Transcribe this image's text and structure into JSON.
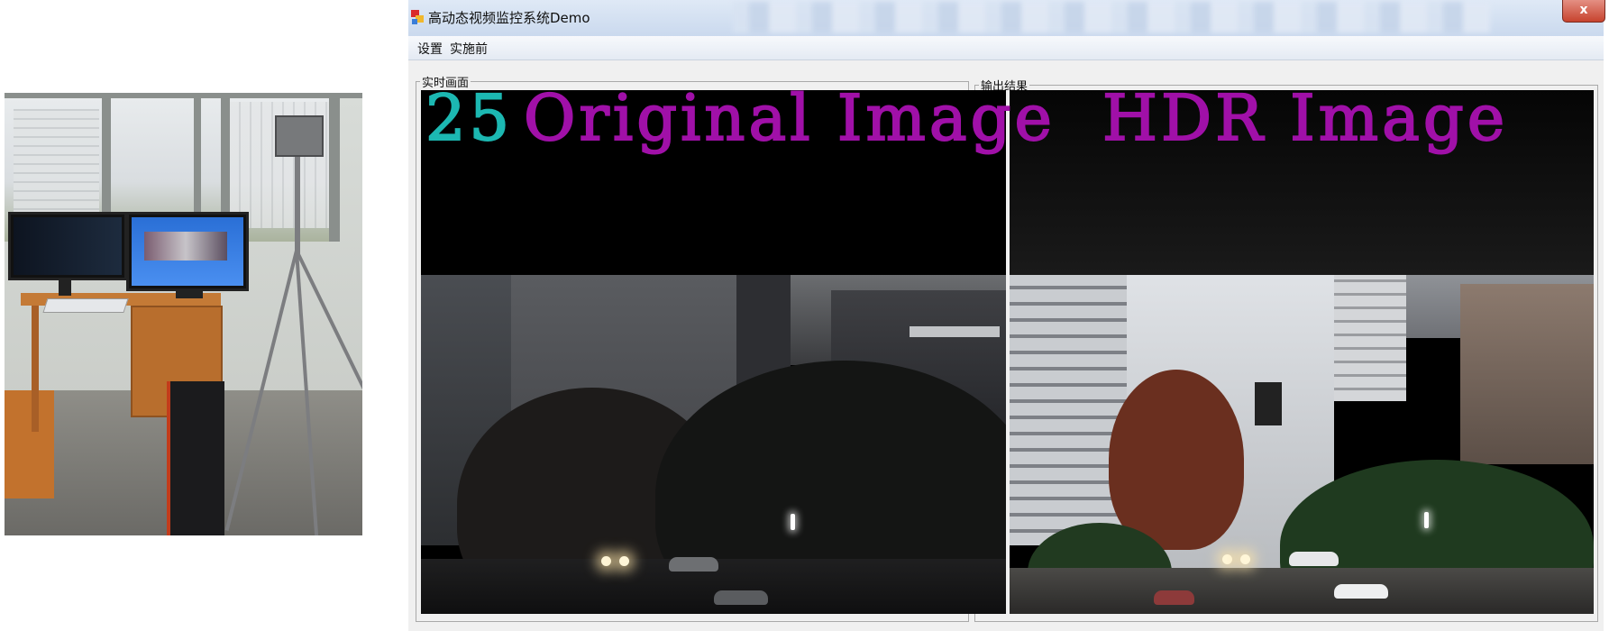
{
  "window": {
    "title": "高动态视频监控系统Demo",
    "close_label": "x"
  },
  "menu": {
    "items": [
      "设置",
      "实施前"
    ]
  },
  "groups": {
    "live_label": "实时画面",
    "output_label": "输出结果"
  },
  "overlay": {
    "frame_counter": "25",
    "original_caption": "Original Image",
    "hdr_caption": "HDR Image"
  },
  "colors": {
    "counter": "#1cb8b2",
    "caption": "#a010a8",
    "titlebar": "#d4e1f2",
    "close_button": "#c7432e"
  },
  "icons": {
    "app": "app-icon",
    "close": "close-icon"
  }
}
